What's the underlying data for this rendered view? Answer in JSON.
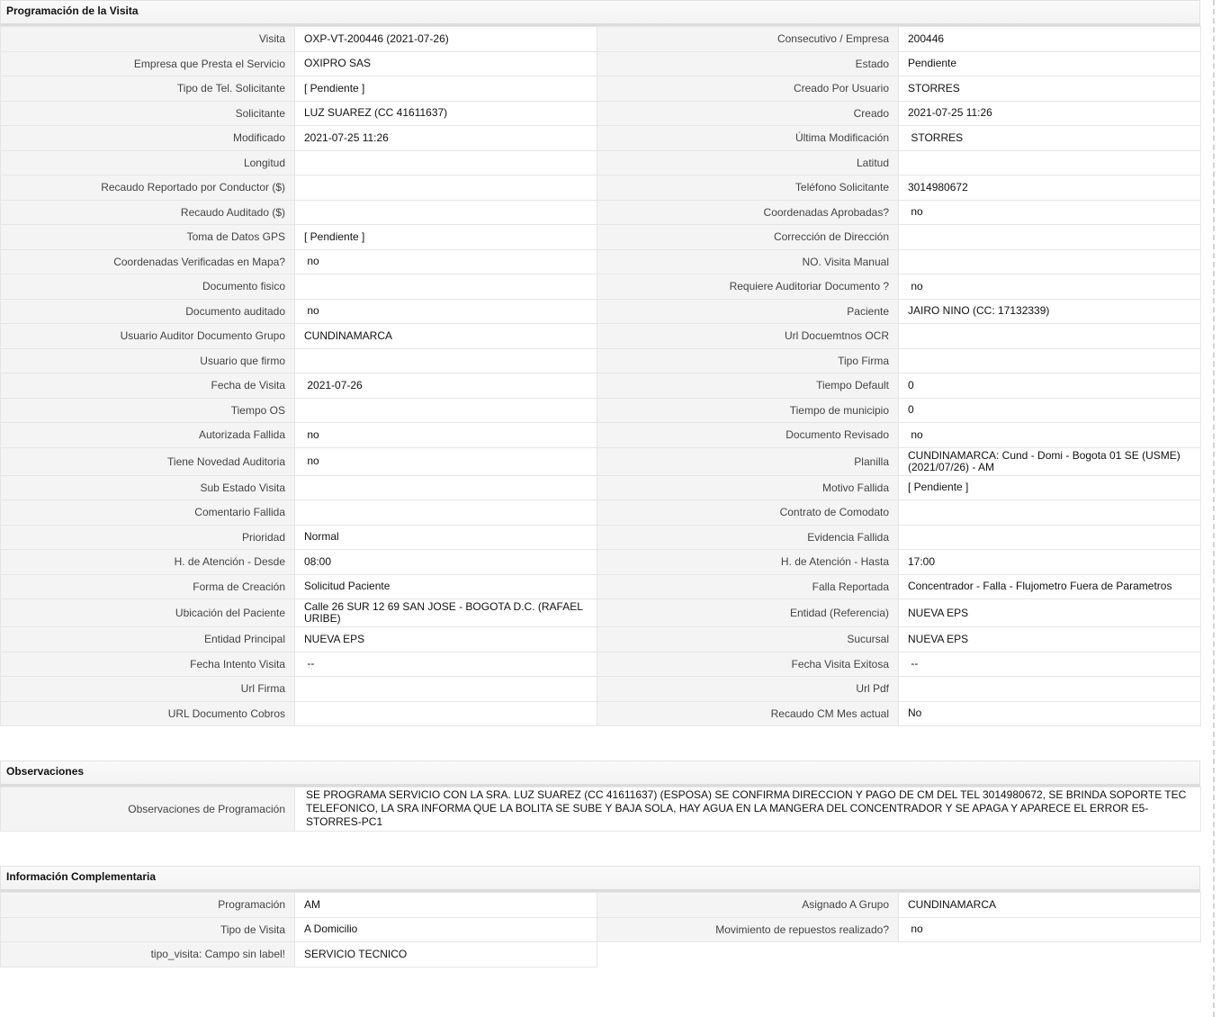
{
  "sections": {
    "programacion": {
      "title": "Programación de la Visita",
      "rows": [
        {
          "l1": "Visita",
          "v1": "OXP-VT-200446 (2021-07-26)",
          "l2": "Consecutivo / Empresa",
          "v2": "200446"
        },
        {
          "l1": "Empresa que Presta el Servicio",
          "v1": "OXIPRO SAS",
          "l2": "Estado",
          "v2": "Pendiente"
        },
        {
          "l1": "Tipo de Tel. Solicitante",
          "v1": "[ Pendiente ]",
          "l2": "Creado Por Usuario",
          "v2": "STORRES"
        },
        {
          "l1": "Solicitante",
          "v1": "LUZ SUAREZ (CC 41611637)",
          "l2": "Creado",
          "v2": "2021-07-25 11:26"
        },
        {
          "l1": "Modificado",
          "v1": "2021-07-25 11:26",
          "l2": "Última Modificación",
          "v2": " STORRES"
        },
        {
          "l1": "Longitud",
          "v1": "",
          "l2": "Latitud",
          "v2": ""
        },
        {
          "l1": "Recaudo Reportado por Conductor ($)",
          "v1": "",
          "l2": "Teléfono Solicitante",
          "v2": "3014980672"
        },
        {
          "l1": "Recaudo Auditado ($)",
          "v1": "",
          "l2": "Coordenadas Aprobadas?",
          "v2": " no"
        },
        {
          "l1": "Toma de Datos GPS",
          "v1": "[ Pendiente ]",
          "l2": "Corrección de Dirección",
          "v2": ""
        },
        {
          "l1": "Coordenadas Verificadas en Mapa?",
          "v1": " no",
          "l2": "NO. Visita Manual",
          "v2": ""
        },
        {
          "l1": "Documento fisico",
          "v1": "",
          "l2": "Requiere Auditoriar Documento ?",
          "v2": " no"
        },
        {
          "l1": "Documento auditado",
          "v1": " no",
          "l2": "Paciente",
          "v2": "JAIRO NINO (CC: 17132339)"
        },
        {
          "l1": "Usuario Auditor Documento Grupo",
          "v1": "CUNDINAMARCA",
          "l2": "Url Docuemtnos OCR",
          "v2": ""
        },
        {
          "l1": "Usuario que firmo",
          "v1": "",
          "l2": "Tipo Firma",
          "v2": ""
        },
        {
          "l1": "Fecha de Visita",
          "v1": " 2021-07-26",
          "l2": "Tiempo Default",
          "v2": "0"
        },
        {
          "l1": "Tiempo OS",
          "v1": "",
          "l2": "Tiempo de municipio",
          "v2": "0"
        },
        {
          "l1": "Autorizada Fallida",
          "v1": " no",
          "l2": "Documento Revisado",
          "v2": " no"
        },
        {
          "l1": "Tiene Novedad Auditoria",
          "v1": " no",
          "l2": "Planilla",
          "v2": "CUNDINAMARCA: Cund - Domi - Bogota 01 SE (USME) (2021/07/26) - AM"
        },
        {
          "l1": "Sub Estado Visita",
          "v1": "",
          "l2": "Motivo Fallida",
          "v2": "[ Pendiente ]"
        },
        {
          "l1": "Comentario Fallida",
          "v1": "",
          "l2": "Contrato de Comodato",
          "v2": ""
        },
        {
          "l1": "Prioridad",
          "v1": "Normal",
          "l2": "Evidencia Fallida",
          "v2": ""
        },
        {
          "l1": "H. de Atención - Desde",
          "v1": "08:00",
          "l2": "H. de Atención - Hasta",
          "v2": "17:00"
        },
        {
          "l1": "Forma de Creación",
          "v1": "Solicitud Paciente",
          "l2": "Falla Reportada",
          "v2": "Concentrador - Falla - Flujometro Fuera de Parametros"
        },
        {
          "l1": "Ubicación del Paciente",
          "v1": "Calle 26 SUR 12 69 SAN JOSE - BOGOTA D.C. (RAFAEL URIBE)",
          "l2": "Entidad (Referencia)",
          "v2": "NUEVA EPS"
        },
        {
          "l1": "Entidad Principal",
          "v1": "NUEVA EPS",
          "l2": "Sucursal",
          "v2": "NUEVA EPS"
        },
        {
          "l1": "Fecha Intento Visita",
          "v1": " --",
          "l2": "Fecha Visita Exitosa",
          "v2": " --"
        },
        {
          "l1": "Url Firma",
          "v1": "",
          "l2": "Url Pdf",
          "v2": ""
        },
        {
          "l1": "URL Documento Cobros",
          "v1": "",
          "l2": "Recaudo CM Mes actual",
          "v2": "No"
        }
      ]
    },
    "observaciones": {
      "title": "Observaciones",
      "label": "Observaciones de Programación",
      "value": "  SE PROGRAMA SERVICIO CON LA SRA. LUZ SUAREZ (CC 41611637) (ESPOSA) SE CONFIRMA DIRECCION Y PAGO DE CM DEL TEL 3014980672, SE BRINDA SOPORTE TEC TELEFONICO, LA SRA INFORMA QUE LA BOLITA SE SUBE Y BAJA SOLA, HAY AGUA EN LA MANGERA DEL CONCENTRADOR Y SE APAGA Y APARECE EL ERROR E5- STORRES-PC1"
    },
    "complementaria": {
      "title": "Información Complementaria",
      "rows": [
        {
          "l1": "Programación",
          "v1": "AM",
          "l2": "Asignado A Grupo",
          "v2": "CUNDINAMARCA"
        },
        {
          "l1": "Tipo de Visita",
          "v1": "A Domicilio",
          "l2": "Movimiento de repuestos realizado?",
          "v2": " no"
        },
        {
          "l1": "tipo_visita: Campo sin label!",
          "v1": "SERVICIO TECNICO",
          "l2": "",
          "v2": ""
        }
      ]
    }
  }
}
